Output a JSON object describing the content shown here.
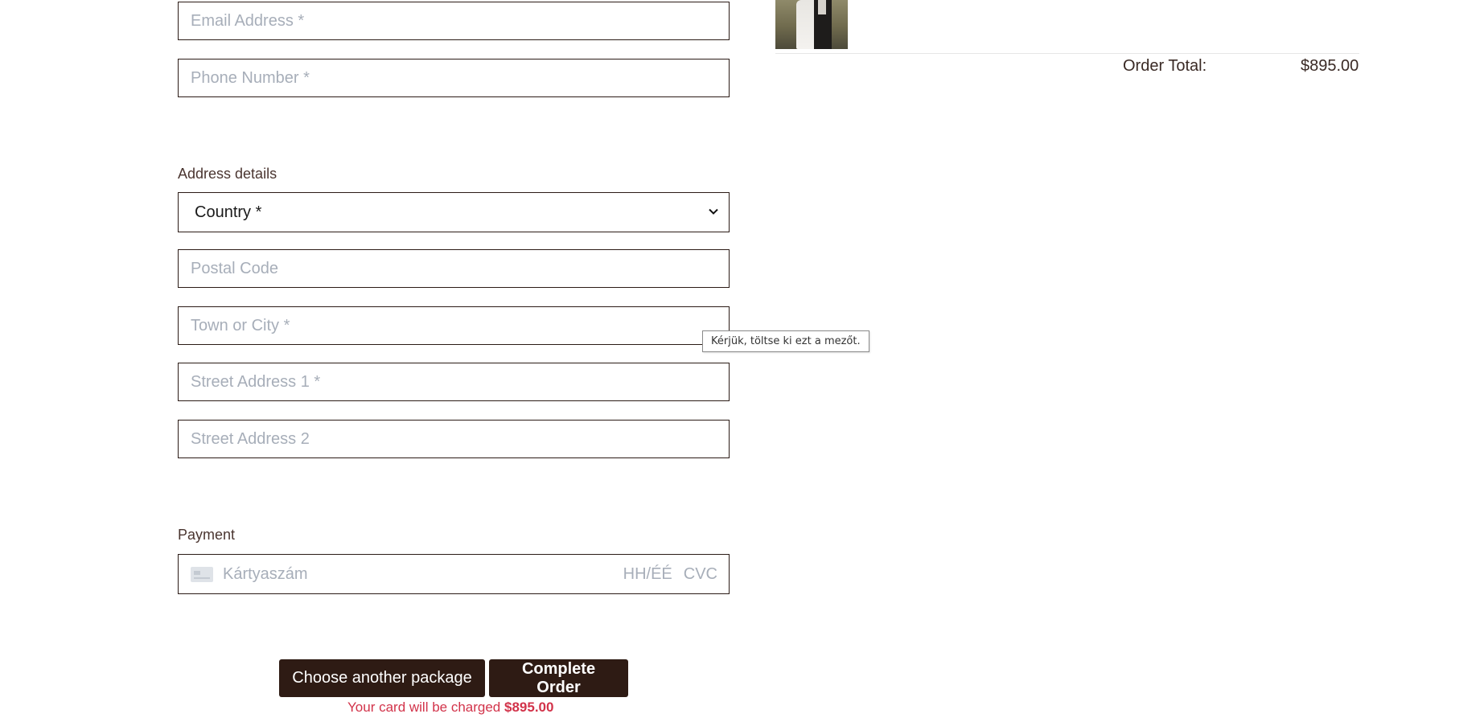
{
  "contact": {
    "email_placeholder": "Email Address *",
    "phone_placeholder": "Phone Number *"
  },
  "address": {
    "section_label": "Address details",
    "country_selected": "Country *",
    "postal_placeholder": "Postal Code",
    "town_placeholder": "Town or City *",
    "street1_placeholder": "Street Address 1 *",
    "street2_placeholder": "Street Address 2"
  },
  "validation": {
    "tooltip": "Kérjük, töltse ki ezt a mezőt."
  },
  "payment": {
    "section_label": "Payment",
    "card_number_placeholder": "Kártyaszám",
    "expiry_placeholder": "HH/ÉÉ",
    "cvc_placeholder": "CVC"
  },
  "actions": {
    "choose_package_label": "Choose another package",
    "complete_order_label": "Complete Order",
    "charge_prefix": "Your card will be charged ",
    "charge_amount": "$895.00"
  },
  "summary": {
    "order_total_label": "Order Total:",
    "order_total_value": "$895.00"
  },
  "colors": {
    "button_bg": "#2e1b14",
    "charge_text": "#d2334a",
    "field_border": "#2b1b16",
    "placeholder": "#a7aeb9"
  }
}
